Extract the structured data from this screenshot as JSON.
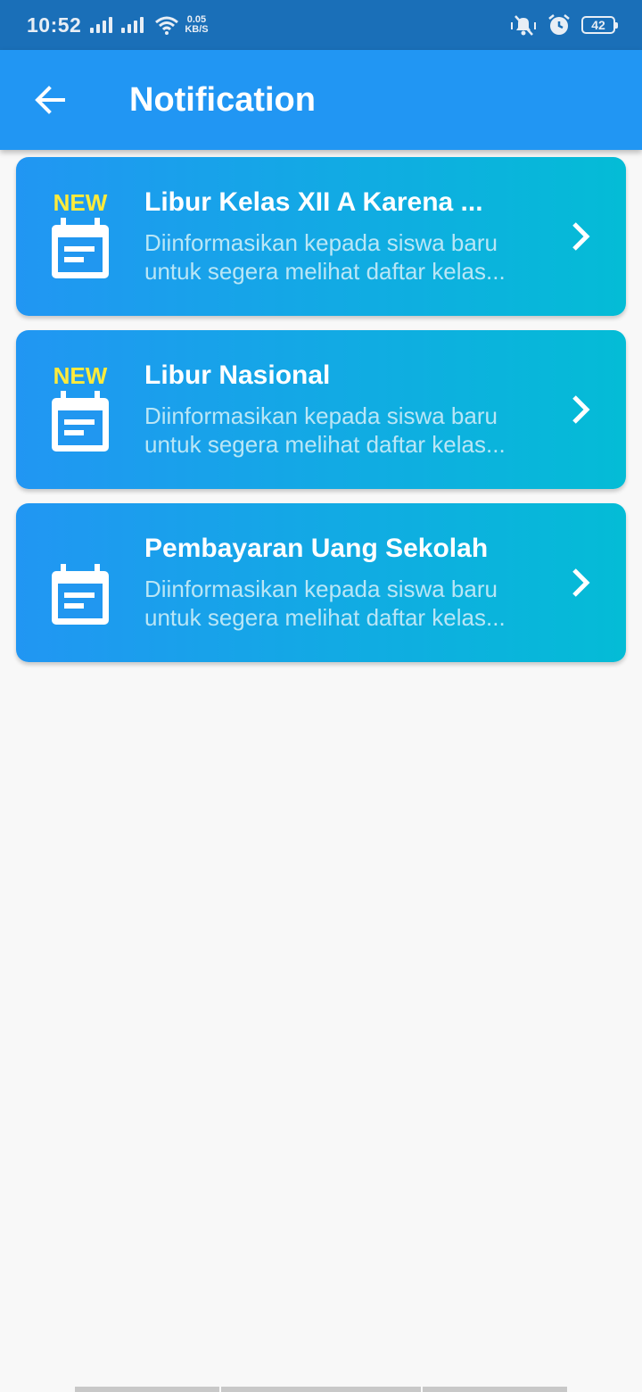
{
  "status_bar": {
    "time": "10:52",
    "net_speed_value": "0.05",
    "net_speed_unit": "KB/S",
    "battery": "42"
  },
  "app_bar": {
    "title": "Notification",
    "back_icon": "arrow-left-icon"
  },
  "notifications": [
    {
      "badge": "NEW",
      "title": "Libur Kelas XII A Karena ...",
      "description": "Diinformasikan kepada siswa baru untuk segera melihat daftar kelas..."
    },
    {
      "badge": "NEW",
      "title": "Libur Nasional",
      "description": "Diinformasikan kepada siswa baru untuk segera melihat daftar kelas..."
    },
    {
      "badge": "",
      "title": "Pembayaran Uang Sekolah",
      "description": "Diinformasikan kepada siswa baru untuk segera melihat daftar kelas..."
    }
  ],
  "colors": {
    "app_bar": "#2196f3",
    "card_gradient_start": "#2196f3",
    "card_gradient_end": "#04bcd6",
    "badge": "#ffeb3b"
  }
}
